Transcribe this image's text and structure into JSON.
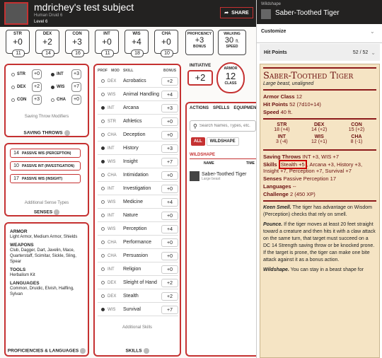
{
  "header": {
    "name": "mdrichey's test subject",
    "subline": "Human  Druid 6",
    "level": "Level 6",
    "share": "SHARE"
  },
  "abilities": [
    {
      "label": "STR",
      "mod": "+0",
      "score": "11"
    },
    {
      "label": "DEX",
      "mod": "+2",
      "score": "14"
    },
    {
      "label": "CON",
      "mod": "+3",
      "score": "16"
    },
    {
      "label": "INT",
      "mod": "+0",
      "score": "11"
    },
    {
      "label": "WIS",
      "mod": "+4",
      "score": "18"
    },
    {
      "label": "CHA",
      "mod": "+0",
      "score": "10"
    }
  ],
  "proficiency": {
    "label": "PROFICIENCY",
    "value": "+3",
    "sub": "BONUS"
  },
  "speed": {
    "label": "WALKING",
    "value": "30",
    "unit": "ft.",
    "sub": "SPEED"
  },
  "initiative": {
    "label": "INITIATIVE",
    "value": "+2"
  },
  "armor": {
    "label": "ARMOR",
    "value": "12",
    "sub": "CLASS"
  },
  "saves": {
    "rows": [
      {
        "label": "STR",
        "value": "+0",
        "prof": false
      },
      {
        "label": "INT",
        "value": "+3",
        "prof": true
      },
      {
        "label": "DEX",
        "value": "+2",
        "prof": false
      },
      {
        "label": "WIS",
        "value": "+7",
        "prof": true
      },
      {
        "label": "CON",
        "value": "+3",
        "prof": false
      },
      {
        "label": "CHA",
        "value": "+0",
        "prof": false
      }
    ],
    "hint": "Saving Throw Modifiers",
    "title": "SAVING THROWS"
  },
  "senses": {
    "rows": [
      {
        "value": "14",
        "label": "PASSIVE WIS (PERCEPTION)"
      },
      {
        "value": "10",
        "label": "PASSIVE INT (INVESTIGATION)"
      },
      {
        "value": "17",
        "label": "PASSIVE WIS (INSIGHT)"
      }
    ],
    "hint": "Additional Sense Types",
    "title": "SENSES"
  },
  "proficiencies": {
    "title": "PROFICIENCIES & LANGUAGES",
    "sections": [
      {
        "head": "ARMOR",
        "text": "Light Armor, Medium Armor, Shields"
      },
      {
        "head": "WEAPONS",
        "text": "Club, Dagger, Dart, Javelin, Mace, Quarterstaff, Scimitar, Sickle, Sling, Spear"
      },
      {
        "head": "TOOLS",
        "text": "Herbalism Kit"
      },
      {
        "head": "LANGUAGES",
        "text": "Common, Druidic, Elvish, Halfling, Sylvan"
      }
    ]
  },
  "skills": {
    "headers": {
      "prof": "PROF",
      "mod": "MOD",
      "skill": "SKILL",
      "bonus": "BONUS"
    },
    "rows": [
      {
        "mod": "DEX",
        "name": "Acrobatics",
        "bonus": "+2",
        "prof": false
      },
      {
        "mod": "WIS",
        "name": "Animal Handling",
        "bonus": "+4",
        "prof": false
      },
      {
        "mod": "INT",
        "name": "Arcana",
        "bonus": "+3",
        "prof": true
      },
      {
        "mod": "STR",
        "name": "Athletics",
        "bonus": "+0",
        "prof": false
      },
      {
        "mod": "CHA",
        "name": "Deception",
        "bonus": "+0",
        "prof": false
      },
      {
        "mod": "INT",
        "name": "History",
        "bonus": "+3",
        "prof": true
      },
      {
        "mod": "WIS",
        "name": "Insight",
        "bonus": "+7",
        "prof": true
      },
      {
        "mod": "CHA",
        "name": "Intimidation",
        "bonus": "+0",
        "prof": false
      },
      {
        "mod": "INT",
        "name": "Investigation",
        "bonus": "+0",
        "prof": false
      },
      {
        "mod": "WIS",
        "name": "Medicine",
        "bonus": "+4",
        "prof": false
      },
      {
        "mod": "INT",
        "name": "Nature",
        "bonus": "+0",
        "prof": false
      },
      {
        "mod": "WIS",
        "name": "Perception",
        "bonus": "+4",
        "prof": false
      },
      {
        "mod": "CHA",
        "name": "Performance",
        "bonus": "+0",
        "prof": false
      },
      {
        "mod": "CHA",
        "name": "Persuasion",
        "bonus": "+0",
        "prof": false
      },
      {
        "mod": "INT",
        "name": "Religion",
        "bonus": "+0",
        "prof": false
      },
      {
        "mod": "DEX",
        "name": "Sleight of Hand",
        "bonus": "+2",
        "prof": false
      },
      {
        "mod": "DEX",
        "name": "Stealth",
        "bonus": "+2",
        "prof": false
      },
      {
        "mod": "WIS",
        "name": "Survival",
        "bonus": "+7",
        "prof": true
      }
    ],
    "hint": "Additional Skills",
    "title": "SKILLS"
  },
  "actions": {
    "tabs": [
      "ACTIONS",
      "SPELLS",
      "EQUIPMENT"
    ],
    "search_placeholder": "Search Names, Types, etc.",
    "filters": [
      "ALL",
      "WILDSHAPE"
    ],
    "section": "WILDSHAPE",
    "cols": {
      "name": "NAME",
      "time": "TIME"
    },
    "item_name": "Saber-Toothed Tiger",
    "item_sub": "Large beast"
  },
  "sidebar": {
    "category": "Wildshape",
    "title": "Saber-Toothed Tiger",
    "customize": "Customize",
    "hp_label": "Hit Points",
    "hp_value": "52 / 52",
    "creature": {
      "name": "Saber-Toothed Tiger",
      "type": "Large beast, unaligned",
      "ac_label": "Armor Class",
      "ac": "12",
      "hp_label": "Hit Points",
      "hp": "52 (7d10+14)",
      "speed_label": "Speed",
      "speed": "40 ft.",
      "abilities": [
        {
          "label": "STR",
          "value": "18 (+4)"
        },
        {
          "label": "DEX",
          "value": "14 (+2)"
        },
        {
          "label": "CON",
          "value": "15 (+2)"
        },
        {
          "label": "INT",
          "value": "3 (-4)"
        },
        {
          "label": "WIS",
          "value": "12 (+1)"
        },
        {
          "label": "CHA",
          "value": "8 (-1)"
        }
      ],
      "saves_label": "Saving Throws",
      "saves": "INT +3, WIS +7",
      "skills_label": "Skills",
      "skills_hl": "Stealth +5",
      "skills_rest": ", Arcana +3, History +3, Insight +7, Perception +7, Survival +7",
      "senses_label": "Senses",
      "senses": "Passive Perception 17",
      "languages_label": "Languages",
      "languages": "--",
      "challenge_label": "Challenge",
      "challenge": "2 (450 XP)",
      "p1_title": "Keen Smell.",
      "p1": " The tiger has advantage on Wisdom (Perception) checks that rely on smell.",
      "p2_title": "Pounce.",
      "p2": " If the tiger moves at least 20 feet straight toward a creature and then hits it with a claw attack on the same turn, that target must succeed on a DC 14 Strength saving throw or be knocked prone. If the target is prone, the tiger can make one bite attack against it as a bonus action.",
      "p3_title": "Wildshape.",
      "p3": " You can stay in a beast shape for"
    }
  }
}
